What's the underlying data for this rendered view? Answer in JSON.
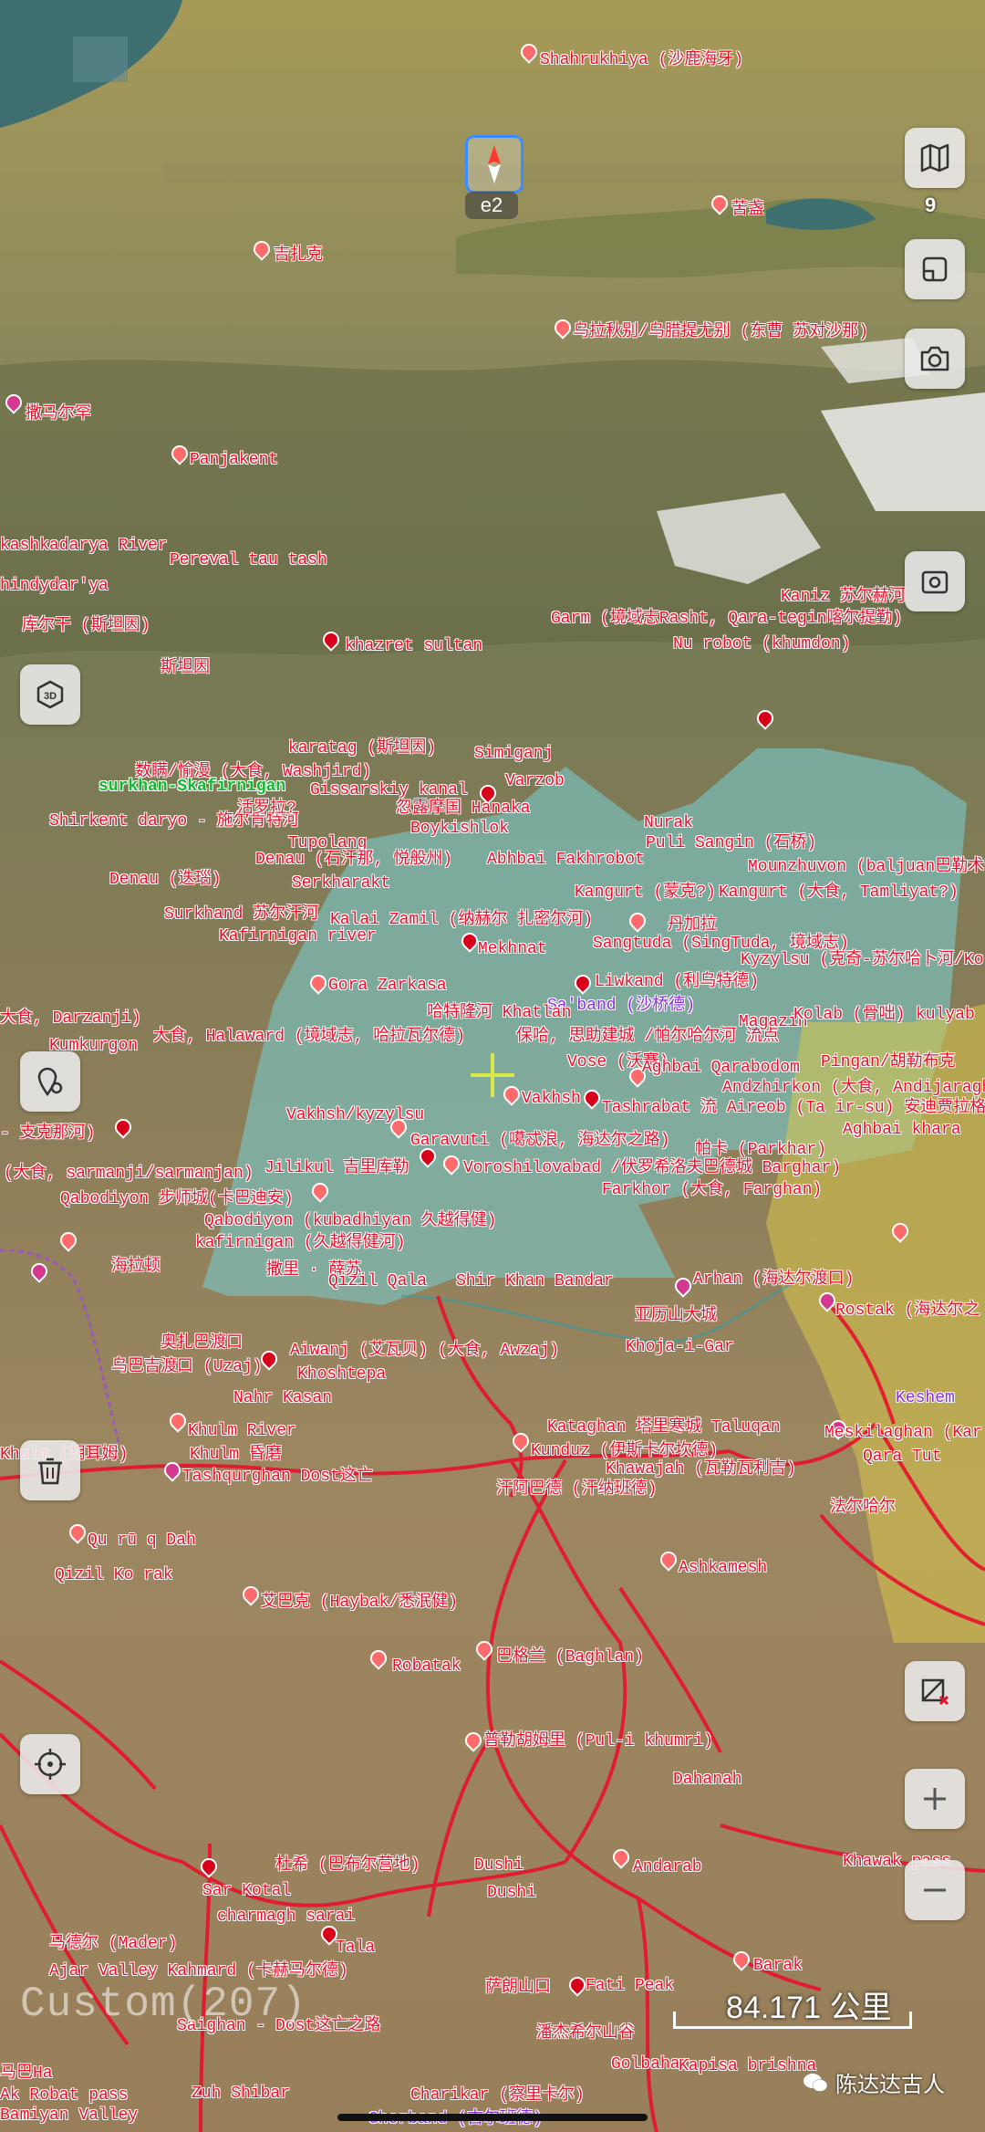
{
  "compass": {
    "label": "e2"
  },
  "controls": {
    "map_layers_count": "9",
    "scale_text": "84.171 公里",
    "custom_label": "Custom(207)",
    "watermark": "陈达达古人"
  },
  "colors": {
    "red_label": "#e8112d",
    "green_label": "#15b832",
    "region_fill": "#79c3c1",
    "yellow_region": "#d8c64b",
    "route": "#e8112d"
  },
  "places": {
    "shahrukhiya": "Shahrukhiya (沙鹿海牙)",
    "kuyu": "苦盏",
    "jizhak": "吉扎克",
    "ulla": "乌拉秋别/乌腊提尤别 (东曹 苏对沙那)",
    "samarkand": "撒马尔罕",
    "panjakent": "Panjakent",
    "kashkadarya": "kashkadarya River",
    "pereval": "Pereval tau tash",
    "gindydar": "hindydar'ya",
    "kurgan": "库尔干 (斯坦因)",
    "sitanyin": "斯坦因",
    "khazret": "khazret sultan",
    "garm": "Garm (境域志Rasht, Qara-tegin喀尔提勤)",
    "kanizz": "Kaniz 苏尔赫河",
    "nurobot": "Nu robot (khumdon)",
    "karatag": "karatag (斯坦因)",
    "shumou": "数瞒/愉漫 (大食, Washjird)",
    "surkhan": "surkhan-Skafirnigan",
    "gissarskiy": "Gissarskiy kanal",
    "simiganj": "Simiganj",
    "varzob": "Varzob",
    "gamma": "忽露摩国 Hanaka",
    "shirkent": "Shirkent daryo - 施尔肯特河",
    "quanbo": "活罗拉?",
    "boykishlok": "Boykishlok",
    "tupolang": "Tupolang",
    "denau": "Denau (迭瑙)",
    "denau2": "Denau (石汗那, 悦般州)",
    "abhbai": "Abhbai Fakhrobot",
    "nurak": "Nurak",
    "puli_sangin": "Puli Sangin (石桥)",
    "kangurt": "Kangurt (蒙克?)",
    "kangurt2": "Kangurt (大食, Tamliyat?)",
    "baljuan": "Mounzhuvon (baljuan巴勒术安)",
    "serkhara": "Serkharakt",
    "kafirnigan": "Kafirnigan river",
    "surkhand": "Surkhand 苏尔汗河",
    "kalai": "Kalai Zamil (纳赫尔 扎密尔河)",
    "mekhnat": "Mekhnat",
    "gora": "Gora Zarkasa",
    "sangtuda": "Sangtuda (SingTuda, 境域志)",
    "danjia": "丹加拉",
    "liwkand": "Liwkand (利乌特德)",
    "kyzylsu": "Kyzylsu (克奇-苏尔哈卜河/Ko",
    "shavand": "Sa'band (沙桥德)",
    "darzanji": "大食, Darzanji)",
    "kumkurgon": "Kumkurgon",
    "halaward": "大食, Halaward (境域志, 哈拉瓦尔德)",
    "hetelonghe": "哈特隆河 Khatlan",
    "bauhe": "保哈, 思助建城 /帕尔哈尔河 流点",
    "magazin": "Magazin",
    "kolab": "Kolab (骨咄)",
    "kulyab": "kulyab",
    "vose": "Vose (沃赛)",
    "aghbai": "Aghbai Qarabodom",
    "pingan": "Pingan/胡勒布克",
    "andzhirkon": "Andzhirkon (大食, Andijaragh",
    "vakhsh": "Vakhsh",
    "tashrabat": "Tashrabat 流 Aireob (Ta ir-su) 安迪贾拉格河",
    "agbai_khara": "Aghbai khara",
    "vakhsh2": "Vakhsh/kyzylsu",
    "garavuti": "Garavuti (噶忒浪, 海达尔之路)",
    "parkhar": "帕卡 (Parkhar)",
    "zhina": "- 支克那河)",
    "jilikul": "Jilikul 吉里库勒",
    "voroshilovabad": "Voroshilovabad /伏罗希洛夫巴德城 Barghar)",
    "sarmanjan": "(大食, sarmanji/sarmanjan)",
    "farkhor": "Farkhor (大食, Farghan)",
    "qabodiyon": "Qabodiyon 步师城(卡巴迪安)",
    "qabodiyon2": "Qabodiyon (kubadhiyan 久越得健)",
    "kafirnigan2": "kafirnigan (久越得健河)",
    "haila": "海拉顿",
    "sahe": "撒里 · 薛苏",
    "qizil": "Qizil Qala",
    "shirkhan": "Shir Khan Bandar",
    "arhan": "Arhan (海达尔渡口)",
    "rostak": "Rostak (海达尔之",
    "yalishan": "亚历山大城",
    "khoja": "Khoja-i-Gar",
    "aojiza": "奥扎巴渡口",
    "aiwanj": "Aiwanj (艾瓦贝) (大食, Awzaj)",
    "uzaj": "乌巴吉渡口 (Uzaj)",
    "khoshtepa": "Khoshtepa",
    "nahr": "Nahr Kasan",
    "keshem": "Keshem",
    "khulm": "Khulm River",
    "khulm2": "Khulm 昏磨",
    "tashqurghan": "Tashqurghan Dost这亡",
    "kataghan": "Kataghan 塔里寒城 Taluqan",
    "kunduz": "Kunduz (伊斯卡尔坎德)",
    "khawajah": "Khawajah (瓦勒瓦利吉)",
    "hangnaban": "汗阿巴德 (汗纳班德)",
    "meshkilaghan": "Meskilaghan (Kar",
    "qaratut": "Qara Tut",
    "faerhaer": "法尔哈尔",
    "quru": "Qu rū q Dah",
    "qizil2": "Qizil Ko rak",
    "ashkamesh": "Ashkamesh",
    "haybak": "艾巴克 (Haybak/悉泯健)",
    "robatak": "Robatak",
    "baghlan": "巴格兰 (Baghlan)",
    "puli": "普勒胡姆里 (Pul-i khumri)",
    "dahanah": "Dahanah",
    "dushi": "Dushi",
    "dushi2": "Dushi",
    "andarab": "Andarab",
    "bargedi": "杜希 (巴布尔营地)",
    "khawak": "Khawak pass",
    "sarkotal": "Sar Kotal",
    "charmagh": "charmagh sarai",
    "tala": "Tala",
    "mader": "马德尔 (Mader)",
    "ajar": "Ajar Valley Kahmard (卡赫马尔德)",
    "saighan": "Saighan - Dost这亡之路",
    "fatipeak": "Fati Peak",
    "barak": "Barak",
    "sahlang": "萨朗山口",
    "panjshir": "潘杰希尔山谷",
    "charikar": "Charikar (察里卡尔)",
    "gulbahar": "Golbahar",
    "kapisa": "Kapisa brishna",
    "ghorband": "Ghorband (古尔班德)",
    "aksobat": "Ak Robat pass",
    "bamian": "Bamiyan Valley",
    "zuhak": "Zuh Shibar",
    "kushan": "Khulm (胡耳姆)",
    "ajarpl": "马巴Ha"
  }
}
